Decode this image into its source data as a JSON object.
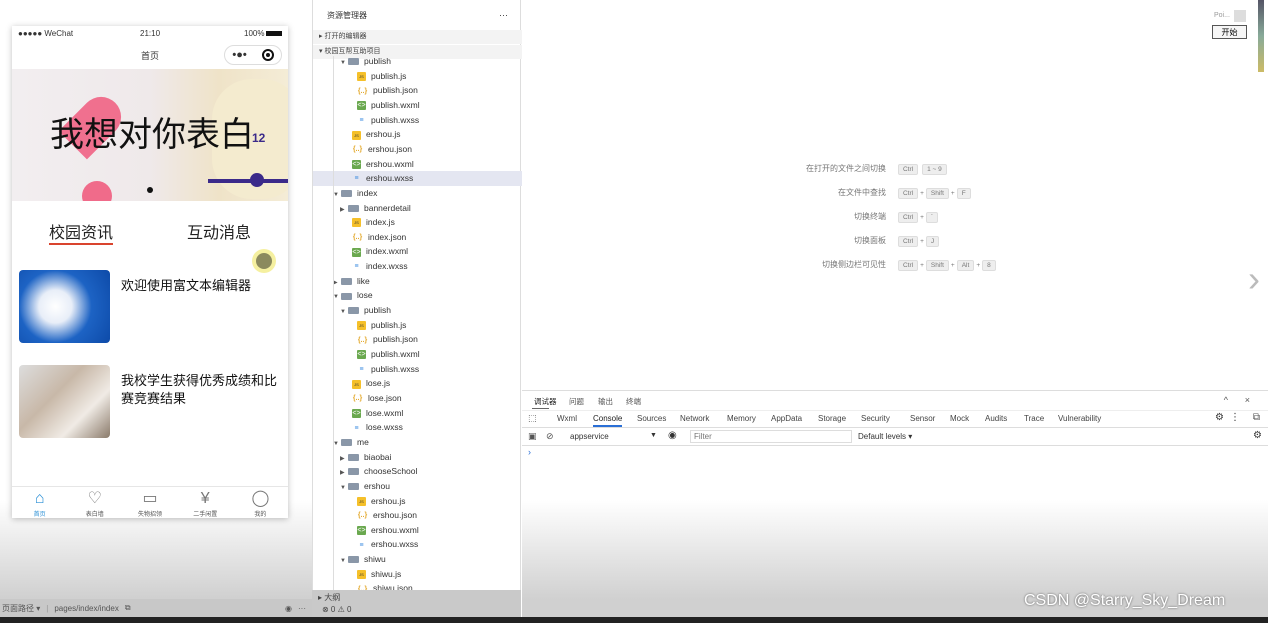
{
  "simulator": {
    "status": {
      "signal": "●●●●● WeChat",
      "time": "21:10",
      "battery": "100%"
    },
    "nav_title": "首页",
    "capsule_more": "•●•",
    "banner": {
      "text": "我想对你表白",
      "clock_num": "12"
    },
    "tabs": [
      {
        "label": "校园资讯",
        "active": true
      },
      {
        "label": "互动消息",
        "active": false
      }
    ],
    "news": [
      {
        "title": "欢迎使用富文本编辑器"
      },
      {
        "title": "我校学生获得优秀成绩和比赛竞赛结果"
      }
    ],
    "tabbar": [
      {
        "label": "首页",
        "icon": "home-icon",
        "active": true
      },
      {
        "label": "表白墙",
        "icon": "heart-icon"
      },
      {
        "label": "失物招领",
        "icon": "box-icon"
      },
      {
        "label": "二手闲置",
        "icon": "yen-bag-icon"
      },
      {
        "label": "我的",
        "icon": "user-icon"
      }
    ],
    "footer": {
      "path_label": "页面路径 ▾",
      "path": "pages/index/index"
    }
  },
  "explorer": {
    "title": "资源管理器",
    "more": "···",
    "open_editors": "打开的编辑器",
    "project": "校园互帮互助项目",
    "outline": "大纲",
    "problems": "⊗ 0 ⚠ 0",
    "rows": [
      {
        "name": "publish",
        "type": "folder",
        "level": 1,
        "open": true
      },
      {
        "name": "publish.js",
        "type": "js",
        "level": 2
      },
      {
        "name": "publish.json",
        "type": "json",
        "level": 2
      },
      {
        "name": "publish.wxml",
        "type": "wxml",
        "level": 2
      },
      {
        "name": "publish.wxss",
        "type": "wxss",
        "level": 2
      },
      {
        "name": "ershou.js",
        "type": "js",
        "level": 1
      },
      {
        "name": "ershou.json",
        "type": "json",
        "level": 1
      },
      {
        "name": "ershou.wxml",
        "type": "wxml",
        "level": 1
      },
      {
        "name": "ershou.wxss",
        "type": "wxss",
        "level": 1,
        "selected": true
      },
      {
        "name": "index",
        "type": "folder",
        "level": 0,
        "open": true
      },
      {
        "name": "bannerdetail",
        "type": "folder",
        "level": 1,
        "open": false
      },
      {
        "name": "index.js",
        "type": "js",
        "level": 1
      },
      {
        "name": "index.json",
        "type": "json",
        "level": 1
      },
      {
        "name": "index.wxml",
        "type": "wxml",
        "level": 1
      },
      {
        "name": "index.wxss",
        "type": "wxss",
        "level": 1
      },
      {
        "name": "like",
        "type": "folder",
        "level": 0,
        "open": false
      },
      {
        "name": "lose",
        "type": "folder",
        "level": 0,
        "open": true
      },
      {
        "name": "publish",
        "type": "folder",
        "level": 1,
        "open": true
      },
      {
        "name": "publish.js",
        "type": "js",
        "level": 2
      },
      {
        "name": "publish.json",
        "type": "json",
        "level": 2
      },
      {
        "name": "publish.wxml",
        "type": "wxml",
        "level": 2
      },
      {
        "name": "publish.wxss",
        "type": "wxss",
        "level": 2
      },
      {
        "name": "lose.js",
        "type": "js",
        "level": 1
      },
      {
        "name": "lose.json",
        "type": "json",
        "level": 1
      },
      {
        "name": "lose.wxml",
        "type": "wxml",
        "level": 1
      },
      {
        "name": "lose.wxss",
        "type": "wxss",
        "level": 1
      },
      {
        "name": "me",
        "type": "folder",
        "level": 0,
        "open": true
      },
      {
        "name": "biaobai",
        "type": "folder",
        "level": 1,
        "open": false
      },
      {
        "name": "chooseSchool",
        "type": "folder",
        "level": 1,
        "open": false
      },
      {
        "name": "ershou",
        "type": "folder",
        "level": 1,
        "open": true
      },
      {
        "name": "ershou.js",
        "type": "js",
        "level": 2
      },
      {
        "name": "ershou.json",
        "type": "json",
        "level": 2
      },
      {
        "name": "ershou.wxml",
        "type": "wxml",
        "level": 2
      },
      {
        "name": "ershou.wxss",
        "type": "wxss",
        "level": 2
      },
      {
        "name": "shiwu",
        "type": "folder",
        "level": 1,
        "open": true
      },
      {
        "name": "shiwu.js",
        "type": "js",
        "level": 2
      },
      {
        "name": "shiwu.json",
        "type": "json",
        "level": 2
      }
    ]
  },
  "editor": {
    "shortcuts": [
      {
        "label": "在打开的文件之间切换",
        "keys": [
          "Ctrl",
          "1 ~ 9"
        ]
      },
      {
        "label": "在文件中查找",
        "keys": [
          "Ctrl",
          "Shift",
          "F"
        ]
      },
      {
        "label": "切换终端",
        "keys": [
          "Ctrl",
          "`"
        ]
      },
      {
        "label": "切换面板",
        "keys": [
          "Ctrl",
          "J"
        ]
      },
      {
        "label": "切换侧边栏可见性",
        "keys": [
          "Ctrl",
          "Shift",
          "Alt",
          "8"
        ]
      }
    ],
    "widget": {
      "label": "Poi...",
      "button": "开始"
    }
  },
  "devtools": {
    "top_tabs": [
      "调试器",
      "问题",
      "输出",
      "终端"
    ],
    "panel_tabs": [
      "Wxml",
      "Console",
      "Sources",
      "Network",
      "Memory",
      "AppData",
      "Storage",
      "Security",
      "Sensor",
      "Mock",
      "Audits",
      "Trace",
      "Vulnerability"
    ],
    "active_panel": "Console",
    "context": "appservice",
    "filter_placeholder": "Filter",
    "levels": "Default levels ▾",
    "prompt": "›"
  },
  "watermark": "CSDN @Starry_Sky_Dream"
}
